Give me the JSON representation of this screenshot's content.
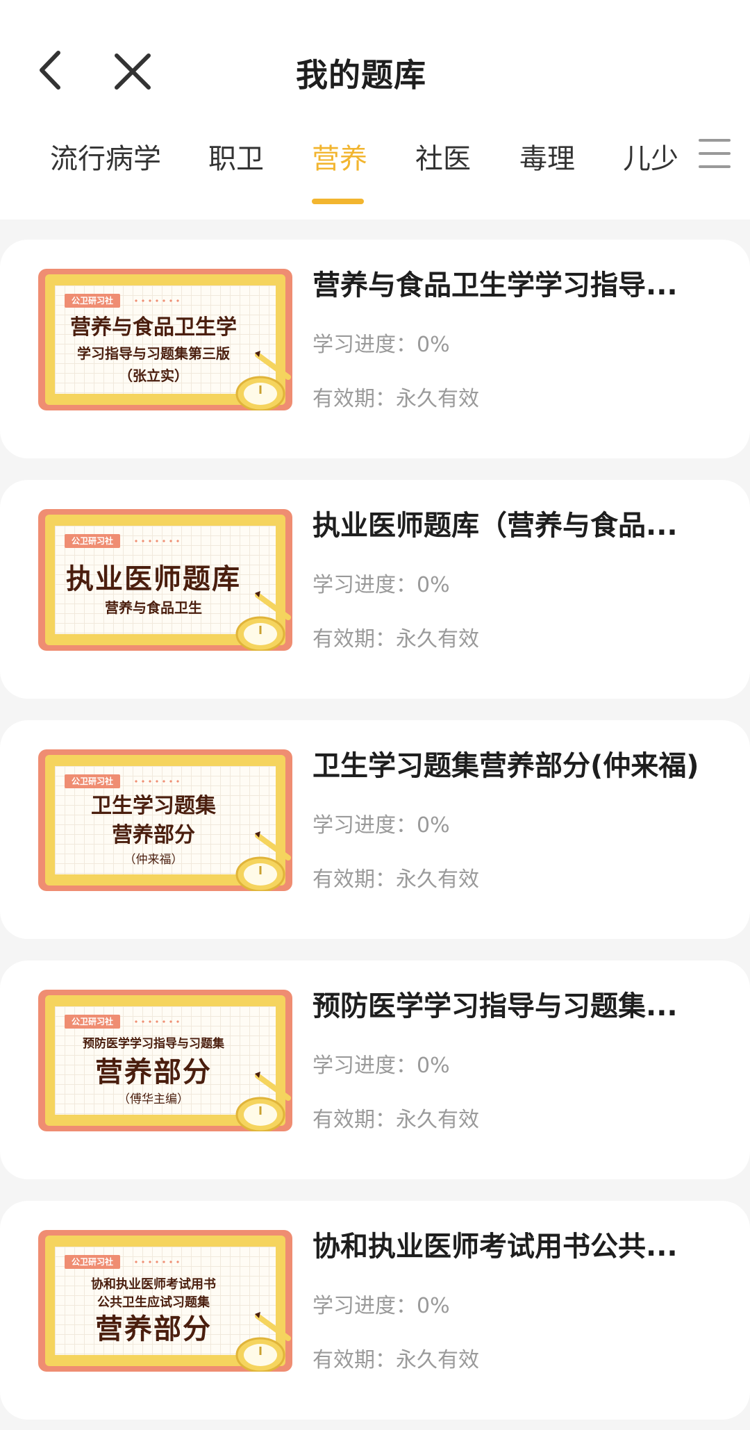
{
  "header": {
    "title": "我的题库"
  },
  "tabs": [
    {
      "label": "流行病学",
      "active": false
    },
    {
      "label": "职卫",
      "active": false
    },
    {
      "label": "营养",
      "active": true
    },
    {
      "label": "社医",
      "active": false
    },
    {
      "label": "毒理",
      "active": false
    },
    {
      "label": "儿少",
      "active": false
    }
  ],
  "theme": {
    "accent": "#f2b52f",
    "cover_frame": "#ef8d72",
    "cover_inner": "#f5d45e",
    "cover_text": "#4a1e0e"
  },
  "items": [
    {
      "title": "营养与食品卫生学学习指导...",
      "progress_label": "学习进度：",
      "progress_value": "0%",
      "valid_label": "有效期：",
      "valid_value": "永久有效",
      "cover": {
        "tag": "公卫研习社",
        "lines": [
          "营养与食品卫生学",
          "学习指导与习题集第三版",
          "（张立实）"
        ]
      }
    },
    {
      "title": "执业医师题库（营养与食品...",
      "progress_label": "学习进度：",
      "progress_value": "0%",
      "valid_label": "有效期：",
      "valid_value": "永久有效",
      "cover": {
        "tag": "公卫研习社",
        "lines": [
          "执业医师题库",
          "营养与食品卫生"
        ]
      }
    },
    {
      "title": "卫生学习题集营养部分(仲来福)",
      "progress_label": "学习进度：",
      "progress_value": "0%",
      "valid_label": "有效期：",
      "valid_value": "永久有效",
      "cover": {
        "tag": "公卫研习社",
        "lines": [
          "卫生学习题集",
          "营养部分",
          "（仲来福）"
        ]
      }
    },
    {
      "title": "预防医学学习指导与习题集...",
      "progress_label": "学习进度：",
      "progress_value": "0%",
      "valid_label": "有效期：",
      "valid_value": "永久有效",
      "cover": {
        "tag": "公卫研习社",
        "lines": [
          "预防医学学习指导与习题集",
          "营养部分",
          "（傅华主编）"
        ]
      }
    },
    {
      "title": "协和执业医师考试用书公共...",
      "progress_label": "学习进度：",
      "progress_value": "0%",
      "valid_label": "有效期：",
      "valid_value": "永久有效",
      "cover": {
        "tag": "公卫研习社",
        "lines": [
          "协和执业医师考试用书",
          "公共卫生应试习题集",
          "营养部分"
        ]
      }
    }
  ]
}
